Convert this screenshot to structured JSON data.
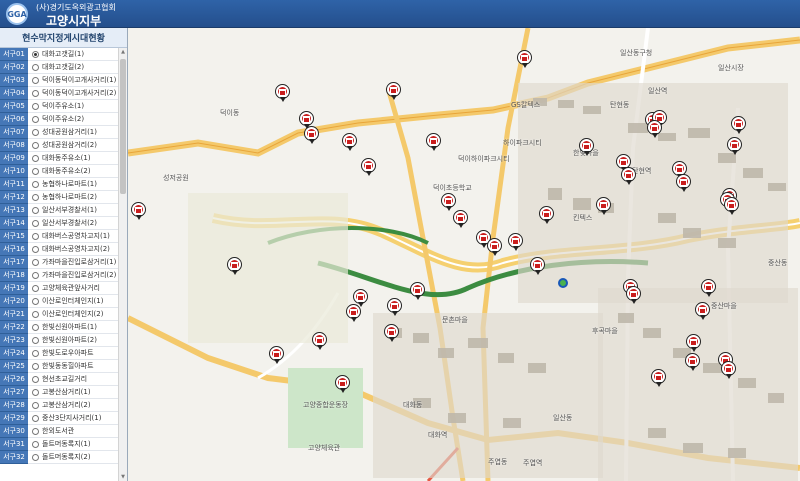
{
  "header": {
    "organization": "(사)경기도옥외광고협회",
    "branch": "고양시지부",
    "logo_text": "GGA"
  },
  "sidebar": {
    "title": "현수막지정게시대현황",
    "items": [
      {
        "code": "서구01",
        "label": "대화고갯길(1)",
        "selected": true
      },
      {
        "code": "서구02",
        "label": "대화고갯길(2)"
      },
      {
        "code": "서구03",
        "label": "덕이동덕이고개사거리(1)"
      },
      {
        "code": "서구04",
        "label": "덕이동덕이고개사거리(2)"
      },
      {
        "code": "서구05",
        "label": "덕이주유소(1)"
      },
      {
        "code": "서구06",
        "label": "덕이주유소(2)"
      },
      {
        "code": "서구07",
        "label": "성대공원삼거리(1)"
      },
      {
        "code": "서구08",
        "label": "성대공원삼거리(2)"
      },
      {
        "code": "서구09",
        "label": "대화동주유소(1)"
      },
      {
        "code": "서구10",
        "label": "대화동주유소(2)"
      },
      {
        "code": "서구11",
        "label": "농협하나로마트(1)"
      },
      {
        "code": "서구12",
        "label": "농협하나로마트(2)"
      },
      {
        "code": "서구13",
        "label": "일산서부경찰서(1)"
      },
      {
        "code": "서구14",
        "label": "일산서부경찰서(2)"
      },
      {
        "code": "서구15",
        "label": "대화버스공영차고지(1)"
      },
      {
        "code": "서구16",
        "label": "대화버스공영차고지(2)"
      },
      {
        "code": "서구17",
        "label": "가좌마을진입로삼거리(1)"
      },
      {
        "code": "서구18",
        "label": "가좌마을진입로삼거리(2)"
      },
      {
        "code": "서구19",
        "label": "고양체육관앞사거리"
      },
      {
        "code": "서구20",
        "label": "이산로인터체인지(1)"
      },
      {
        "code": "서구21",
        "label": "이산로인터체인지(2)"
      },
      {
        "code": "서구22",
        "label": "한빛신원아파트(1)"
      },
      {
        "code": "서구23",
        "label": "한빛신원아파트(2)"
      },
      {
        "code": "서구24",
        "label": "한빛도로우아파트"
      },
      {
        "code": "서구25",
        "label": "한빛동동힐아파트"
      },
      {
        "code": "서구26",
        "label": "현선초교길거리"
      },
      {
        "code": "서구27",
        "label": "고봉산삼거리(1)"
      },
      {
        "code": "서구28",
        "label": "고봉산삼거리(2)"
      },
      {
        "code": "서구29",
        "label": "중산3단지사거리(1)"
      },
      {
        "code": "서구30",
        "label": "한외도서관"
      },
      {
        "code": "서구31",
        "label": "돌트머동록지(1)"
      },
      {
        "code": "서구32",
        "label": "돌트머동록지(2)"
      }
    ]
  },
  "map": {
    "labels": [
      {
        "id": "l1",
        "text": "덕이동"
      },
      {
        "id": "l2",
        "text": "일산동"
      },
      {
        "id": "l3",
        "text": "대화동"
      },
      {
        "id": "l4",
        "text": "주엽동"
      },
      {
        "id": "l5",
        "text": "탄현동"
      },
      {
        "id": "l6",
        "text": "중산동"
      },
      {
        "id": "l7",
        "text": "고양종합운동장"
      },
      {
        "id": "l8",
        "text": "킨텍스"
      },
      {
        "id": "l9",
        "text": "고양체육관"
      },
      {
        "id": "l10",
        "text": "일산시장"
      },
      {
        "id": "l11",
        "text": "한빛마을"
      },
      {
        "id": "l12",
        "text": "성저공원"
      },
      {
        "id": "l13",
        "text": "덕이초등학교"
      },
      {
        "id": "l14",
        "text": "대화역"
      },
      {
        "id": "l15",
        "text": "주엽역"
      },
      {
        "id": "l16",
        "text": "일산역"
      },
      {
        "id": "l17",
        "text": "중산마을"
      },
      {
        "id": "l18",
        "text": "덕이하이파크시티"
      },
      {
        "id": "l19",
        "text": "후곡마을"
      },
      {
        "id": "l20",
        "text": "문촌마을"
      },
      {
        "id": "l21",
        "text": "하이파크시티"
      },
      {
        "id": "l22",
        "text": "GS칼텍스"
      },
      {
        "id": "l23",
        "text": "탄현역"
      },
      {
        "id": "l24",
        "text": "일산동구청"
      }
    ],
    "marker_count": 48
  }
}
